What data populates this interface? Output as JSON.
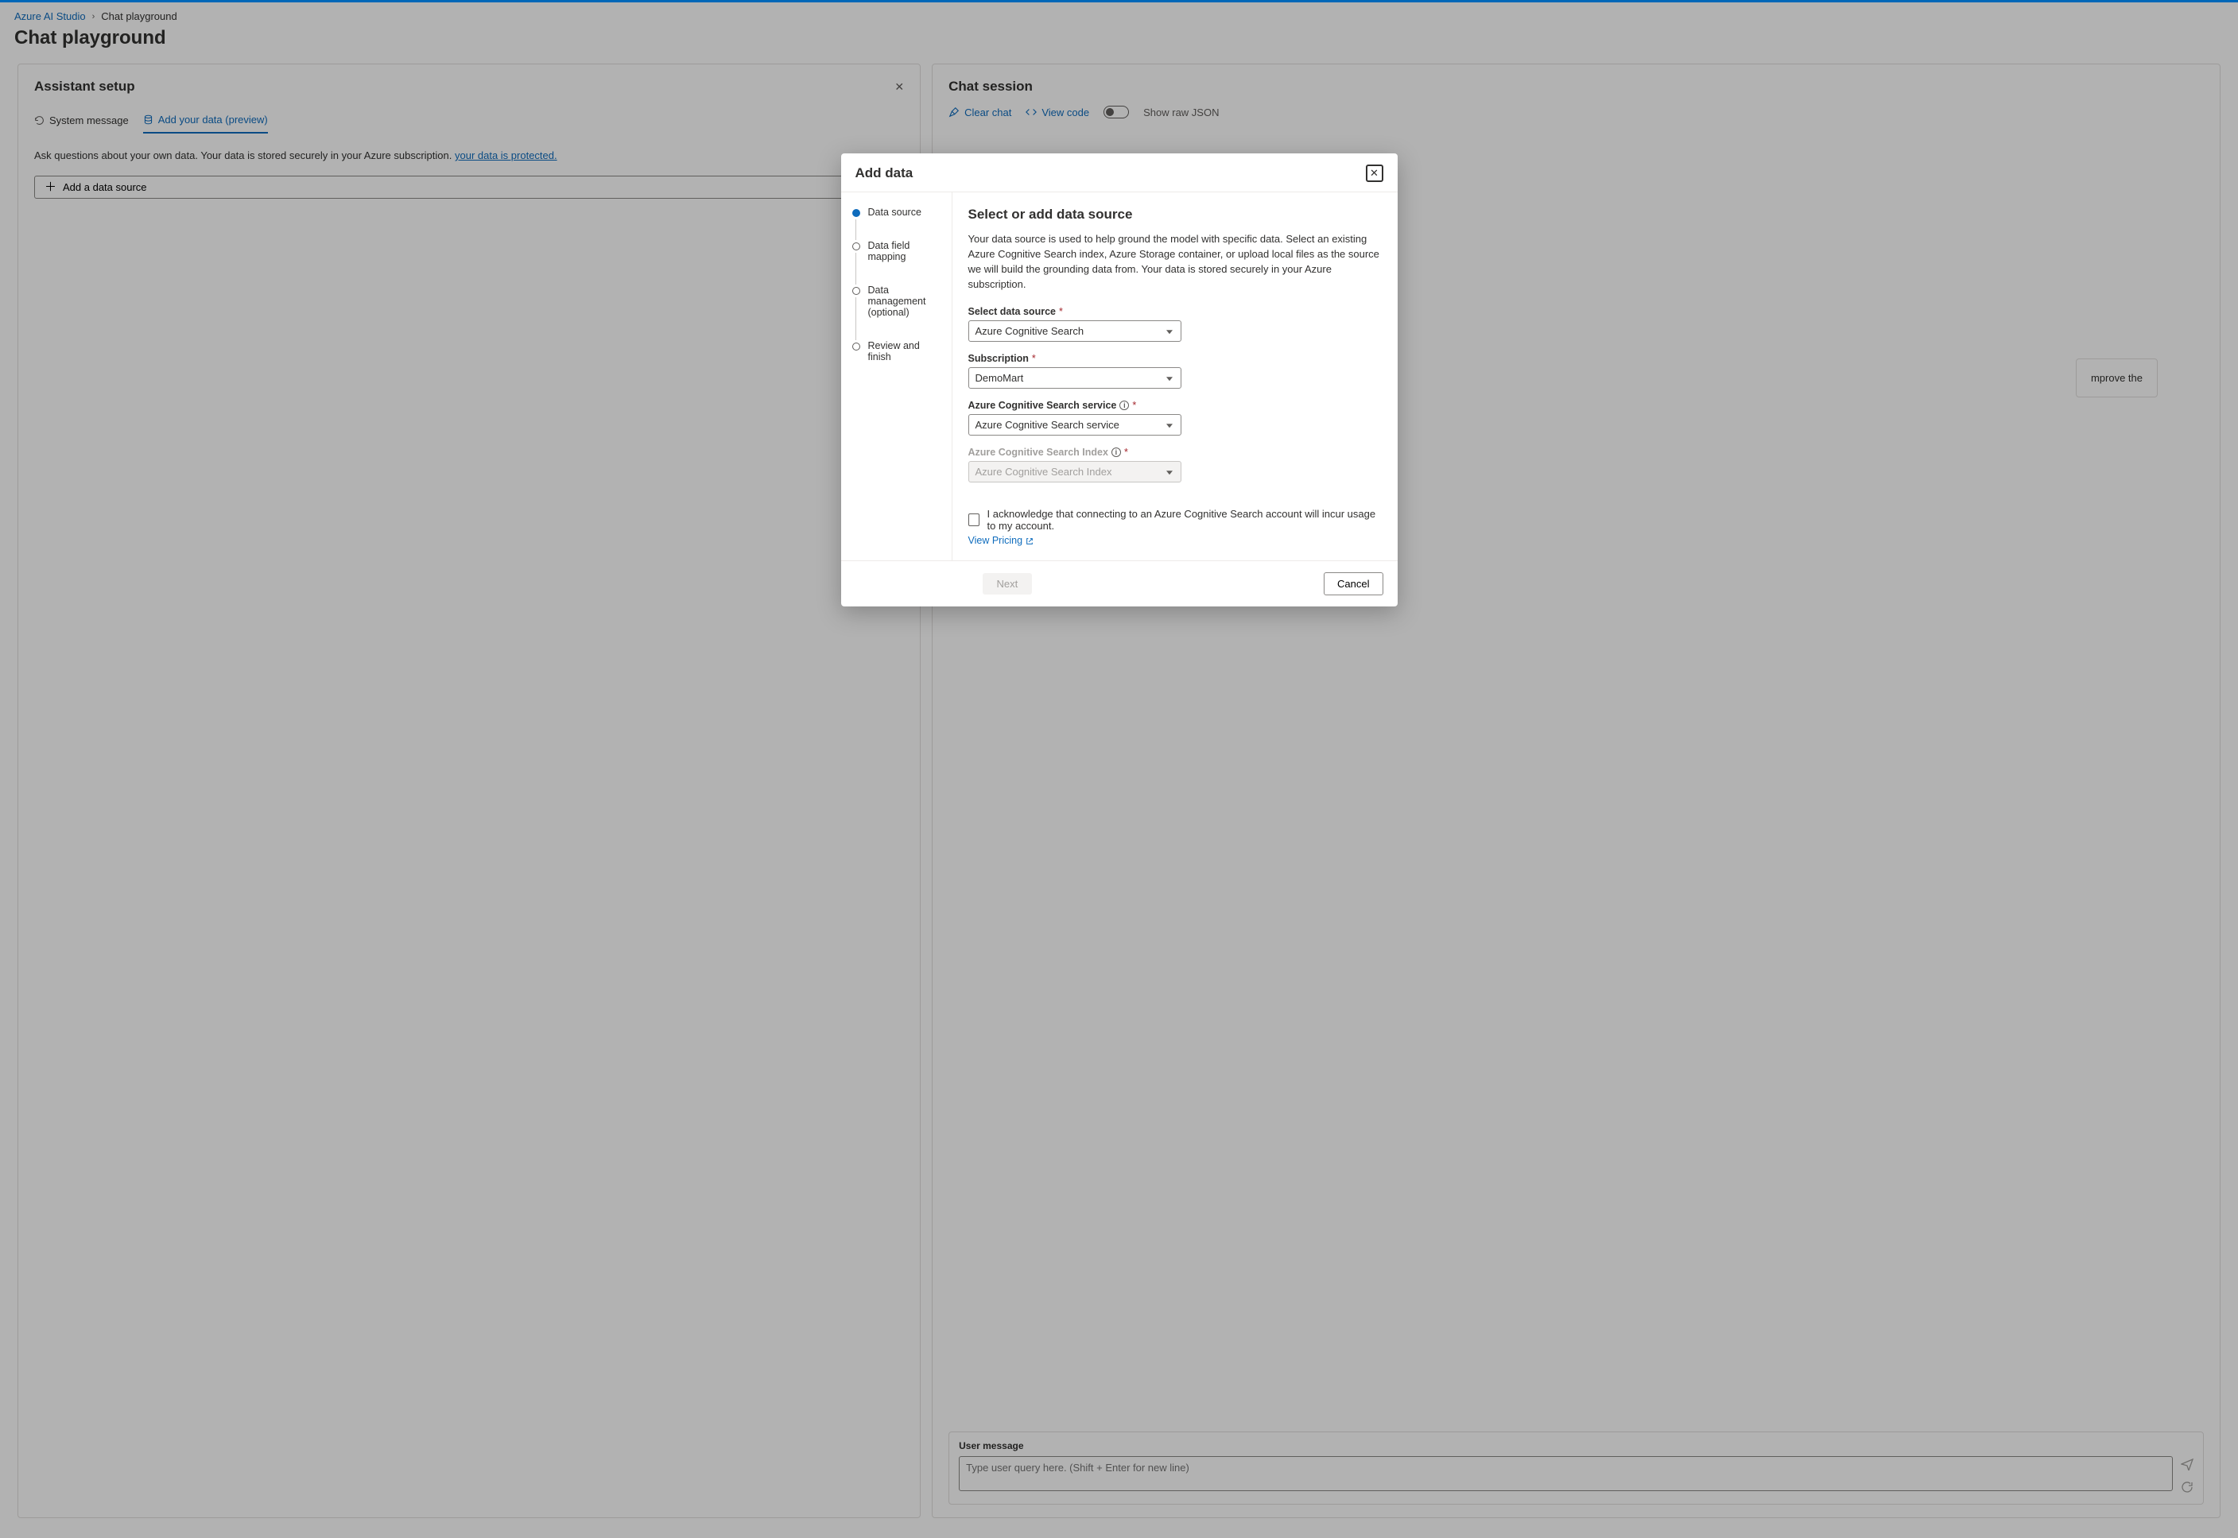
{
  "breadcrumb": {
    "root": "Azure AI Studio",
    "current": "Chat playground"
  },
  "page_title": "Chat playground",
  "left_panel": {
    "title": "Assistant setup",
    "tabs": {
      "system_msg": "System message",
      "add_data": "Add your data (preview)"
    },
    "help_text": "Ask questions about your own data. Your data is stored securely in your Azure subscription.",
    "help_link": "your data is protected.",
    "add_btn": "Add a data source"
  },
  "right_panel": {
    "title": "Chat session",
    "toolbar": {
      "clear": "Clear chat",
      "view_code": "View code",
      "show_raw": "Show raw JSON"
    },
    "hint_fragment": "mprove the",
    "input_label": "User message",
    "input_placeholder": "Type user query here. (Shift + Enter for new line)"
  },
  "modal": {
    "title": "Add data",
    "steps": [
      "Data source",
      "Data field mapping",
      "Data management (optional)",
      "Review and finish"
    ],
    "section_title": "Select or add data source",
    "description": "Your data source is used to help ground the model with specific data. Select an existing Azure Cognitive Search index, Azure Storage container, or upload local files as the source we will build the grounding data from. Your data is stored securely in your Azure subscription.",
    "fields": {
      "data_source": {
        "label": "Select data source",
        "value": "Azure Cognitive Search"
      },
      "subscription": {
        "label": "Subscription",
        "value": "DemoMart"
      },
      "search_service": {
        "label": "Azure Cognitive Search service",
        "value": "Azure Cognitive Search service"
      },
      "search_index": {
        "label": "Azure Cognitive Search Index",
        "value": "Azure Cognitive Search Index"
      }
    },
    "ack_text": "I acknowledge that connecting to an Azure Cognitive Search account will incur usage to my account.",
    "pricing_link": "View Pricing",
    "next_btn": "Next",
    "cancel_btn": "Cancel"
  }
}
